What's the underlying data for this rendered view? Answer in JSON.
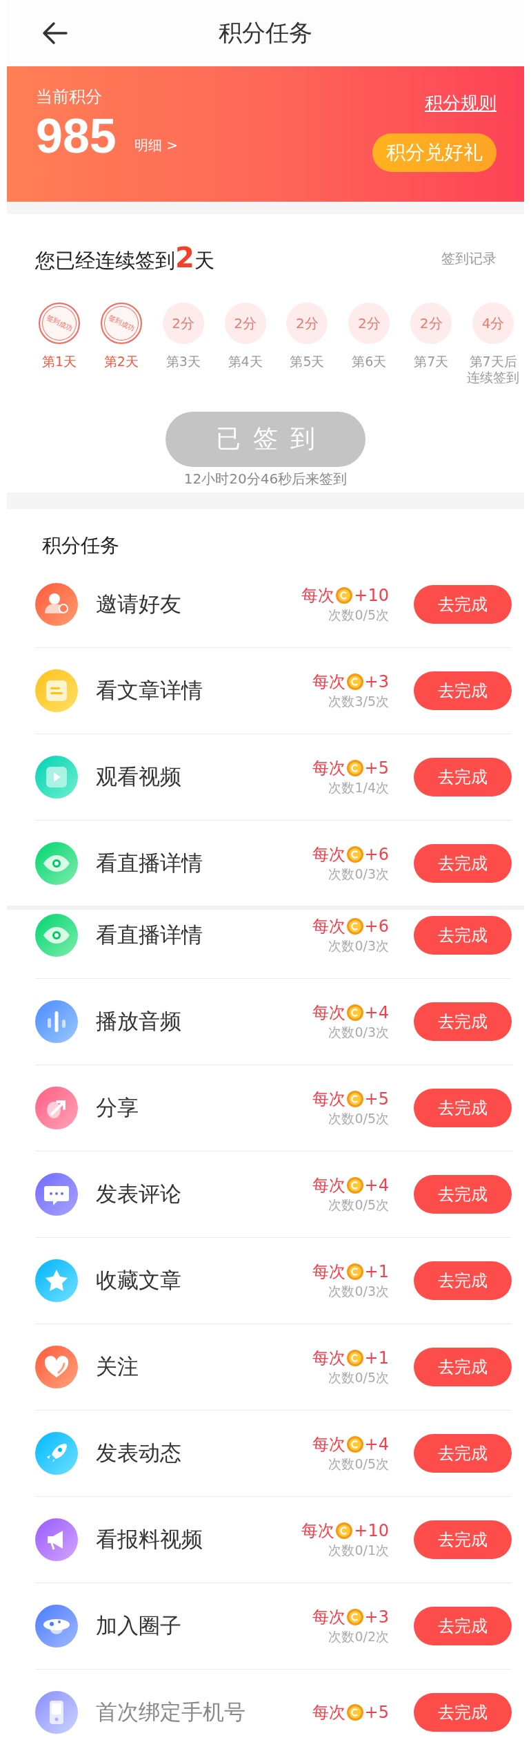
{
  "header": {
    "title": "积分任务"
  },
  "points": {
    "label": "当前积分",
    "value": "985",
    "detail_link": "明细 >",
    "rules_link": "积分规则",
    "redeem_button": "积分兑好礼"
  },
  "checkin": {
    "headline": "您已经连续签到**2**天",
    "record_link": "签到记录",
    "days": [
      {
        "label": "第1天",
        "signed": true,
        "stamp": "签到成功"
      },
      {
        "label": "第2天",
        "signed": true,
        "stamp": "签到成功"
      },
      {
        "label": "第3天",
        "signed": false,
        "points": "2分"
      },
      {
        "label": "第4天",
        "signed": false,
        "points": "2分"
      },
      {
        "label": "第5天",
        "signed": false,
        "points": "2分"
      },
      {
        "label": "第6天",
        "signed": false,
        "points": "2分"
      },
      {
        "label": "第7天",
        "signed": false,
        "points": "2分"
      },
      {
        "label": "第7天后连续签到",
        "signed": false,
        "points": "4分"
      }
    ],
    "button": {
      "label": "已签到",
      "done": true
    },
    "countdown": "12小时20分46秒后来签到"
  },
  "tasks": {
    "title": "积分任务",
    "items": [
      {
        "kind": "person",
        "name": "邀请好友",
        "per": "每次",
        "reward": "+10",
        "count": "次数0/5次",
        "muted": false,
        "button": "去完成"
      },
      {
        "kind": "article",
        "name": "看文章详情",
        "per": "每次",
        "reward": "+3",
        "count": "次数3/5次",
        "muted": false,
        "button": "去完成"
      },
      {
        "kind": "video",
        "name": "观看视频",
        "per": "每次",
        "reward": "+5",
        "count": "次数1/4次",
        "muted": false,
        "button": "去完成"
      },
      {
        "kind": "eye",
        "name": "看直播详情",
        "per": "每次",
        "reward": "+6",
        "count": "次数0/3次",
        "muted": false,
        "button": "去完成"
      }
    ]
  },
  "tasks_continued": [
    {
      "kind": "eye",
      "name": "看直播详情",
      "per": "每次",
      "reward": "+6",
      "count": "次数0/3次",
      "muted": false,
      "button": "去完成"
    },
    {
      "kind": "audio",
      "name": "播放音频",
      "per": "每次",
      "reward": "+4",
      "count": "次数0/3次",
      "muted": false,
      "button": "去完成"
    },
    {
      "kind": "share",
      "name": "分享",
      "per": "每次",
      "reward": "+5",
      "count": "次数0/5次",
      "muted": false,
      "button": "去完成"
    },
    {
      "kind": "comment",
      "name": "发表评论",
      "per": "每次",
      "reward": "+4",
      "count": "次数0/5次",
      "muted": false,
      "button": "去完成"
    },
    {
      "kind": "star",
      "name": "收藏文章",
      "per": "每次",
      "reward": "+1",
      "count": "次数0/3次",
      "muted": false,
      "button": "去完成"
    },
    {
      "kind": "heart",
      "name": "关注",
      "per": "每次",
      "reward": "+1",
      "count": "次数0/5次",
      "muted": false,
      "button": "去完成"
    },
    {
      "kind": "rocket",
      "name": "发表动态",
      "per": "每次",
      "reward": "+4",
      "count": "次数0/5次",
      "muted": false,
      "button": "去完成"
    },
    {
      "kind": "megaphone",
      "name": "看报料视频",
      "per": "每次",
      "reward": "+10",
      "count": "次数0/1次",
      "muted": false,
      "button": "去完成"
    },
    {
      "kind": "planet",
      "name": "加入圈子",
      "per": "每次",
      "reward": "+3",
      "count": "次数0/2次",
      "muted": false,
      "button": "去完成"
    },
    {
      "kind": "phone",
      "name": "首次绑定手机号",
      "per": "每次",
      "reward": "+5",
      "muted": true,
      "button": "去完成"
    }
  ]
}
